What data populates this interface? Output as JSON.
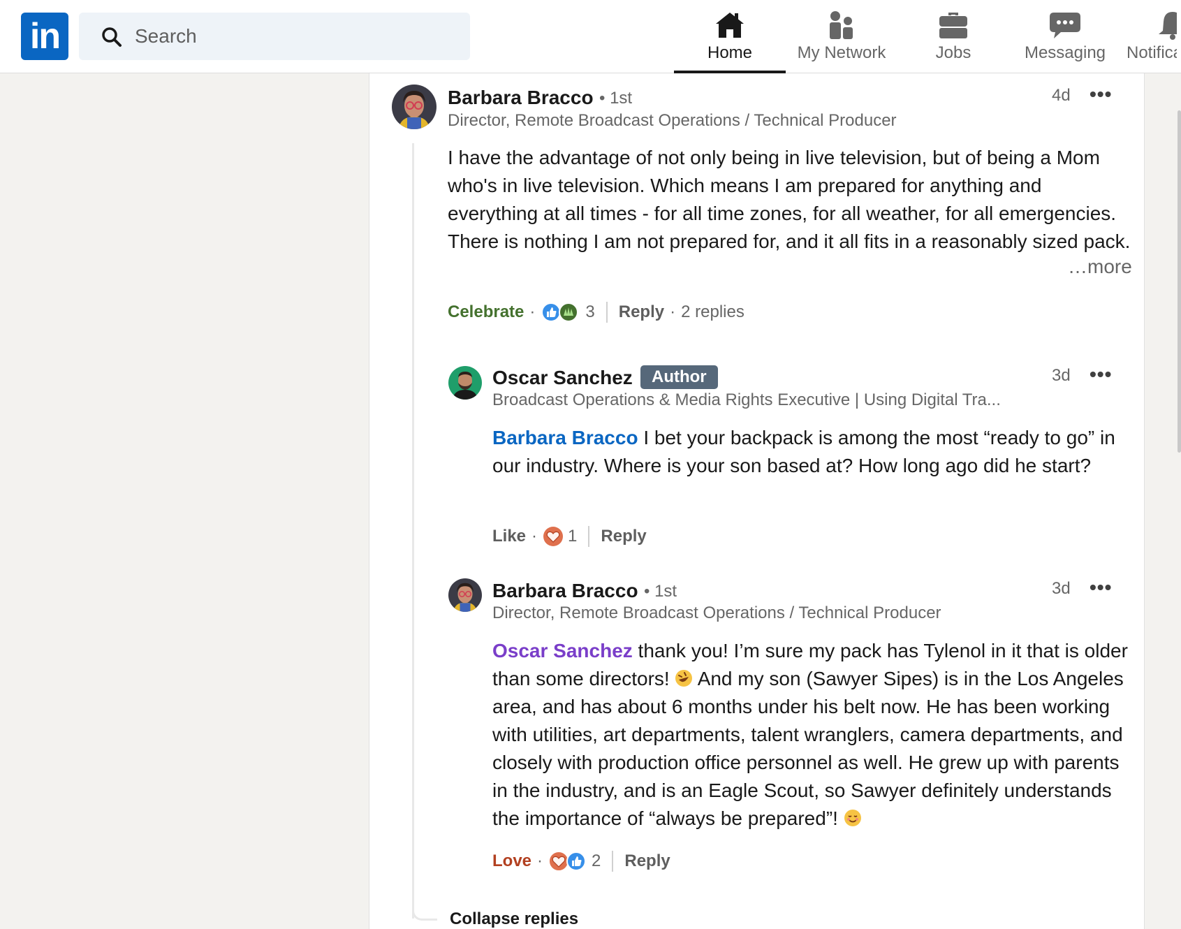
{
  "header": {
    "logo_text": "in",
    "search": {
      "placeholder": "Search",
      "value": ""
    },
    "nav": [
      {
        "label": "Home",
        "icon": "home-icon",
        "active": true
      },
      {
        "label": "My Network",
        "icon": "people-icon",
        "active": false
      },
      {
        "label": "Jobs",
        "icon": "briefcase-icon",
        "active": false
      },
      {
        "label": "Messaging",
        "icon": "chat-icon",
        "active": false
      },
      {
        "label": "Notifica",
        "icon": "bell-icon",
        "active": false
      }
    ]
  },
  "comment": {
    "author": "Barbara Bracco",
    "degree": "• 1st",
    "headline": "Director, Remote Broadcast Operations / Technical Producer",
    "time": "4d",
    "menu": "•••",
    "text": "I have the advantage of not only being in live television, but of being a Mom who's in live television. Which means I am prepared for anything and everything at all times - for all time zones, for all weather, for all emergencies. There is nothing I am not prepared for, and it all fits in a reasonably sized pack.",
    "more": "…more",
    "reaction_label": "Celebrate",
    "reaction_count": "3",
    "reply_label": "Reply",
    "replies_label": "2 replies"
  },
  "replies": [
    {
      "author": "Oscar Sanchez",
      "badge": "Author",
      "headline": "Broadcast Operations & Media Rights Executive | Using Digital Tra...",
      "time": "3d",
      "menu": "•••",
      "mention": "Barbara Bracco",
      "text": " I bet your backpack is among the most “ready to go” in our industry. Where is your son based at? How long ago did he start?",
      "reaction_label": "Like",
      "reaction_count": "1",
      "reply_label": "Reply"
    },
    {
      "author": "Barbara Bracco",
      "degree": "• 1st",
      "headline": "Director, Remote Broadcast Operations / Technical Producer",
      "time": "3d",
      "menu": "•••",
      "mention": "Oscar Sanchez",
      "text_a": " thank you! I’m sure my pack has Tylenol in it that is older than some directors! ",
      "text_b": " And my son (Sawyer Sipes) is in the Los Angeles area, and has about 6 months under his belt now. He has been working with utilities, art departments, talent wranglers, camera departments, and closely with production office personnel as well. He grew up with parents in the industry, and is an Eagle Scout, so Sawyer definitely understands the importance of “always be prepared”! ",
      "reaction_label": "Love",
      "reaction_count": "2",
      "reply_label": "Reply"
    }
  ],
  "collapse_label": "Collapse replies",
  "colors": {
    "brand": "#0a66c2",
    "celebrate": "#44712e",
    "love": "#b24020",
    "mention_blue": "#0a66c2",
    "mention_purple": "#7a3ec9"
  }
}
